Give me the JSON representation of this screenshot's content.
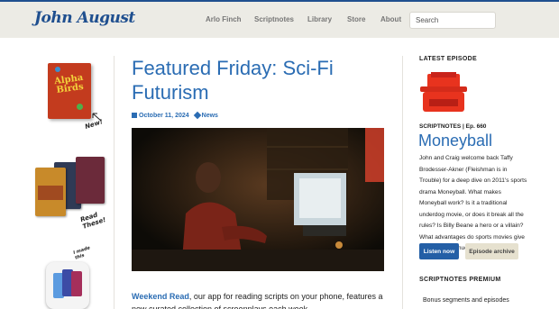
{
  "header": {
    "logo": "John August",
    "nav": [
      "Arlo Finch",
      "Scriptnotes",
      "Library",
      "Store",
      "About"
    ],
    "search_placeholder": "Search"
  },
  "left": {
    "book1_title": "Alpha Birds",
    "note1": "New!",
    "note2_line1": "Read",
    "note2_line2": "These!",
    "note3_line1": "I made",
    "note3_line2": "this"
  },
  "post": {
    "title": "Featured Friday: Sci-Fi Futurism",
    "date": "October 11, 2024",
    "category": "News",
    "body_link": "Weekend Read",
    "body_text": ", our app for reading scripts on your phone, features a new curated collection of screenplays each week."
  },
  "sidebar": {
    "latest_heading": "LATEST EPISODE",
    "episode_label": "SCRIPTNOTES | Ep. 660",
    "episode_title": "Moneyball",
    "episode_desc": "John and Craig welcome back Taffy Brodesser-Akner (Fleishman is in Trouble) for a deep dive on 2011's sports drama Moneyball. What makes Moneyball work? Is it a traditional underdog movie, or does it break all the rules? Is Billy Beane a hero or a villain? What advantages do sports movies give you, and how much [...]",
    "listen_button": "Listen now",
    "archive_button": "Episode archive",
    "premium_heading": "SCRIPTNOTES PREMIUM",
    "premium_item": "Bonus segments and episodes"
  },
  "colors": {
    "brand_blue": "#2a6cb3",
    "header_bg": "#ecebe5",
    "typewriter_red": "#e8331e",
    "button_blue": "#245fa6"
  }
}
